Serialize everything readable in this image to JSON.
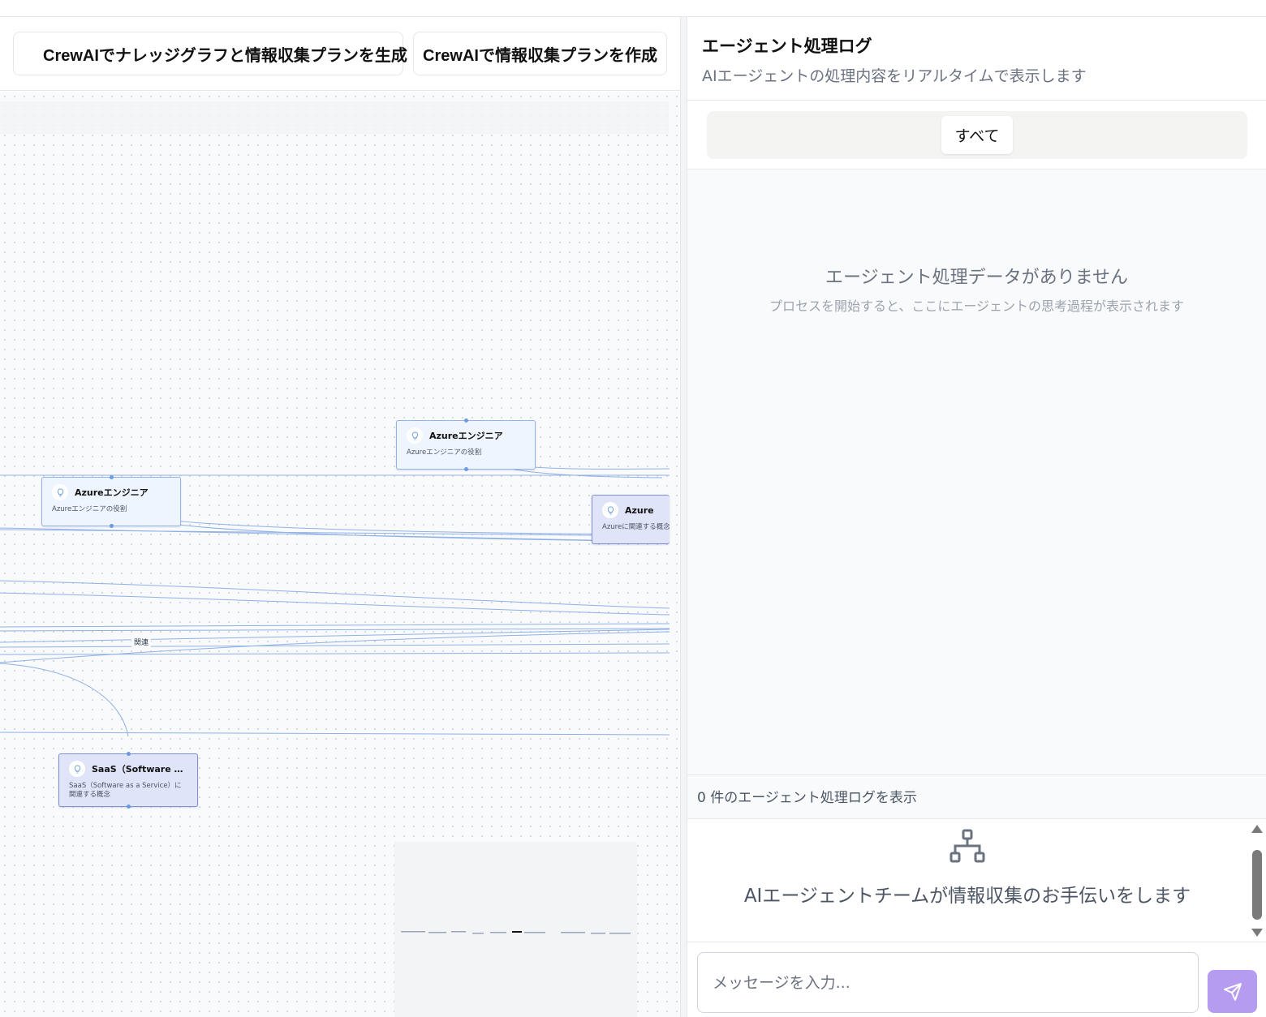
{
  "toolbar": {
    "generate_graph_label": "CrewAIでナレッジグラフと情報収集プランを生成",
    "create_plan_label": "CrewAIで情報収集プランを作成"
  },
  "graph": {
    "nodes": [
      {
        "title": "Azureエンジニア",
        "description": "Azureエンジニアの役割"
      },
      {
        "title": "Azureエンジニア",
        "description": "Azureエンジニアの役割"
      },
      {
        "title": "Azure",
        "description": "Azureに関連する概念"
      },
      {
        "title": "SaaS（Software as a Se...",
        "description": "SaaS（Software as a Service）に関連する概念"
      }
    ],
    "edge_label": "関連"
  },
  "panel": {
    "title": "エージェント処理ログ",
    "subtitle": "AIエージェントの処理内容をリアルタイムで表示します",
    "tab_all": "すべて",
    "empty_title": "エージェント処理データがありません",
    "empty_subtitle": "プロセスを開始すると、ここにエージェントの思考過程が表示されます",
    "count_text": "0 件のエージェント処理ログを表示"
  },
  "chat": {
    "intro": "AIエージェントチームが情報収集のお手伝いをします",
    "input_placeholder": "メッセージを入力..."
  },
  "icons": {
    "sparkle": "sparkles-icon",
    "node": "lightbulb-icon",
    "chat": "network-icon",
    "send": "send-icon"
  },
  "colors": {
    "accent": "#7c3aed",
    "send_button": "#b69cf0",
    "edge": "#8fb1e6"
  }
}
